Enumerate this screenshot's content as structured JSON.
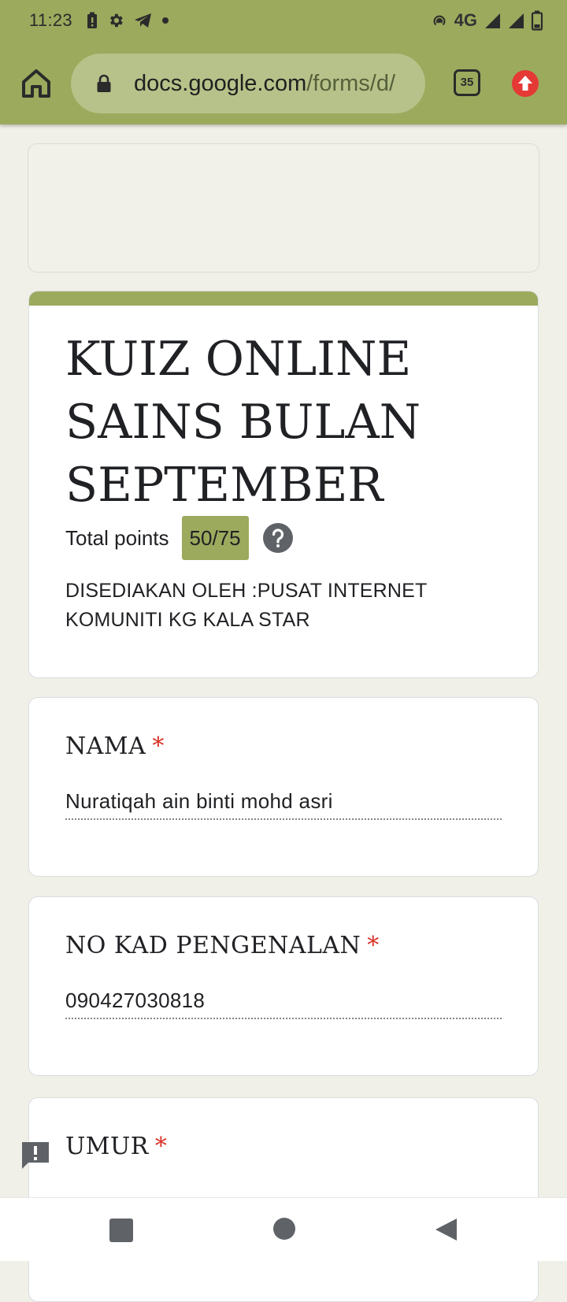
{
  "status_bar": {
    "time": "11:23",
    "network": "4G",
    "icons": [
      "battery-alert-icon",
      "gear-icon",
      "telegram-icon",
      "dot-icon",
      "hotspot-icon",
      "signal-icon",
      "signal-icon",
      "battery-icon"
    ]
  },
  "browser": {
    "url_host": "docs.google.com",
    "url_path": "/forms/d/",
    "tab_count": "35",
    "toolbar_color": "#9caa5e"
  },
  "form": {
    "title": "KUIZ ONLINE SAINS BULAN SEPTEMBER",
    "points_label": "Total points",
    "points_value": "50/75",
    "description": "DISEDIAKAN OLEH :PUSAT INTERNET KOMUNITI KG KALA STAR",
    "required_mark": "*",
    "accent_color": "#9caa5e",
    "questions": [
      {
        "title": "NAMA",
        "answer": "Nuratiqah ain binti mohd asri"
      },
      {
        "title": "NO KAD PENGENALAN",
        "answer": "090427030818"
      },
      {
        "title": "UMUR",
        "answer": ""
      }
    ]
  }
}
